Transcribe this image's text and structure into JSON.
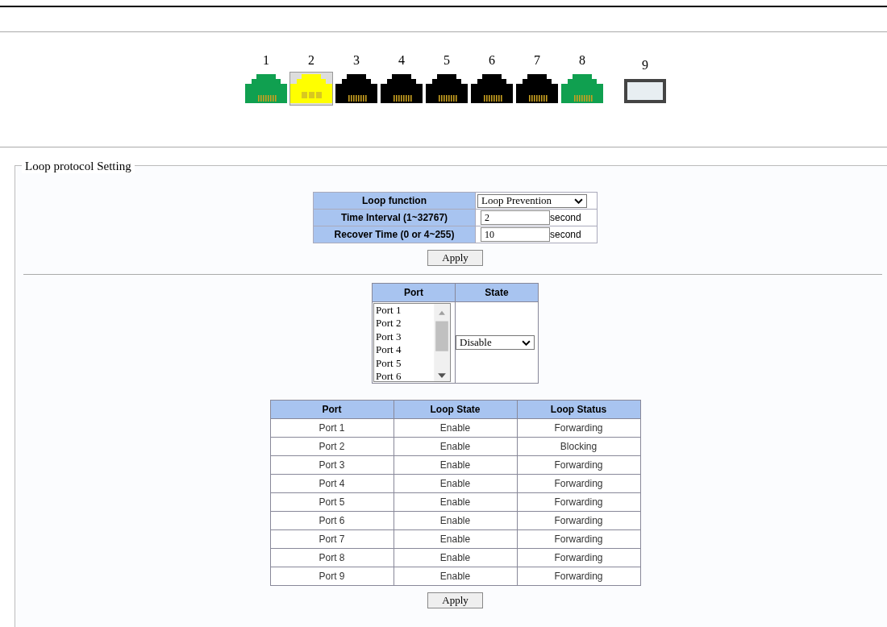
{
  "ports": [
    {
      "label": "1",
      "kind": "copper",
      "color": "#10a050"
    },
    {
      "label": "2",
      "kind": "copper",
      "color": "#ffff00"
    },
    {
      "label": "3",
      "kind": "copper",
      "color": "#000000"
    },
    {
      "label": "4",
      "kind": "copper",
      "color": "#000000"
    },
    {
      "label": "5",
      "kind": "copper",
      "color": "#000000"
    },
    {
      "label": "6",
      "kind": "copper",
      "color": "#000000"
    },
    {
      "label": "7",
      "kind": "copper",
      "color": "#000000"
    },
    {
      "label": "8",
      "kind": "copper",
      "color": "#10a050"
    },
    {
      "label": "9",
      "kind": "fiber",
      "color": "#e8eef2"
    }
  ],
  "section": {
    "title": "Loop protocol Setting"
  },
  "settings": {
    "rows": [
      {
        "label": "Loop function",
        "kind": "select",
        "value": "Loop Prevention"
      },
      {
        "label": "Time Interval (1~32767)",
        "kind": "input",
        "value": "2",
        "unit": "second"
      },
      {
        "label": "Recover Time (0 or 4~255)",
        "kind": "input",
        "value": "10",
        "unit": "second"
      }
    ],
    "apply": "Apply"
  },
  "port_state": {
    "columns": [
      "Port",
      "State"
    ],
    "ports": [
      "Port 1",
      "Port 2",
      "Port 3",
      "Port 4",
      "Port 5",
      "Port 6"
    ],
    "state": "Disable"
  },
  "status_table": {
    "columns": [
      "Port",
      "Loop State",
      "Loop Status"
    ],
    "rows": [
      [
        "Port 1",
        "Enable",
        "Forwarding"
      ],
      [
        "Port 2",
        "Enable",
        "Blocking"
      ],
      [
        "Port 3",
        "Enable",
        "Forwarding"
      ],
      [
        "Port 4",
        "Enable",
        "Forwarding"
      ],
      [
        "Port 5",
        "Enable",
        "Forwarding"
      ],
      [
        "Port 6",
        "Enable",
        "Forwarding"
      ],
      [
        "Port 7",
        "Enable",
        "Forwarding"
      ],
      [
        "Port 8",
        "Enable",
        "Forwarding"
      ],
      [
        "Port 9",
        "Enable",
        "Forwarding"
      ]
    ],
    "apply": "Apply"
  }
}
